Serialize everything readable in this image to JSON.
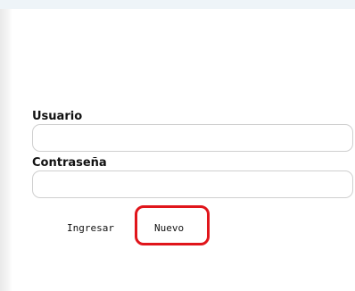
{
  "login_form": {
    "username_label": "Usuario",
    "username_value": "",
    "password_label": "Contraseña",
    "password_value": ""
  },
  "actions": {
    "login_label": "Ingresar",
    "new_label": "Nuevo"
  },
  "colors": {
    "highlight": "#e0151b",
    "top_band": "#eef4f8"
  }
}
